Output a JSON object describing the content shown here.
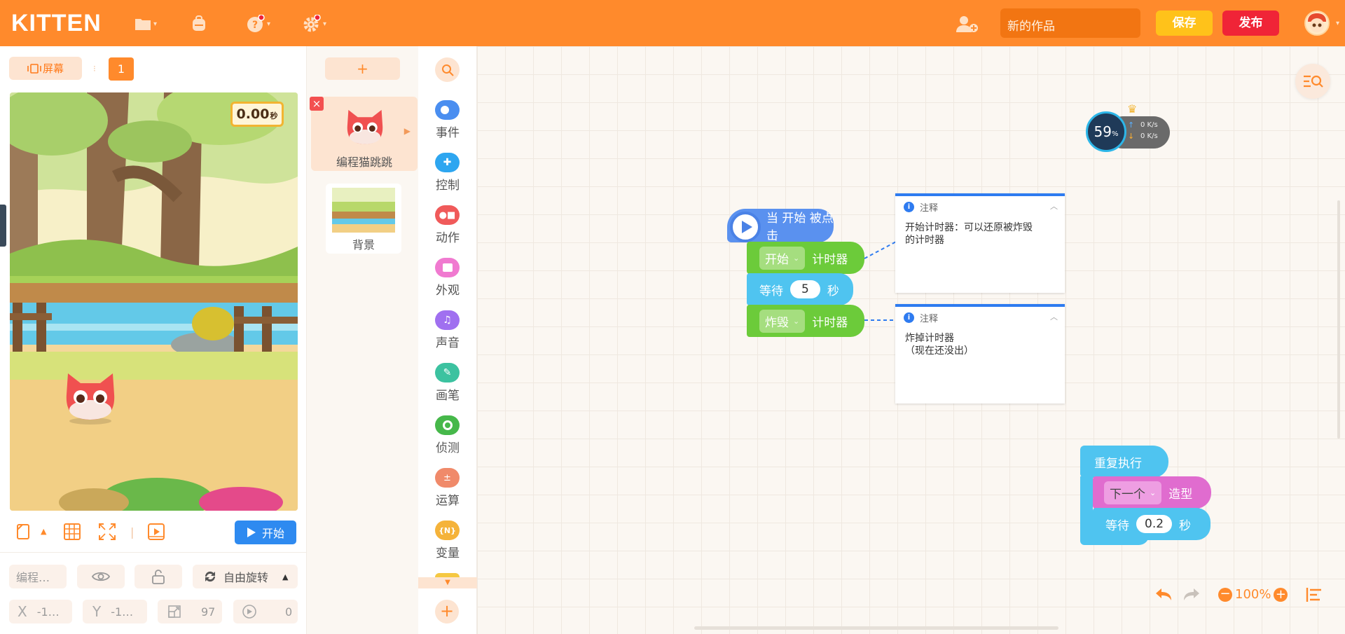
{
  "app": {
    "logo": "KITTEN",
    "project_name_placeholder": "新的作品",
    "save_label": "保存",
    "publish_label": "发布"
  },
  "stage_panel": {
    "screen_label": "屏幕",
    "page_number": "1",
    "timer_value": "0.00",
    "timer_unit": "秒",
    "start_label": "开始",
    "sprite_name_short": "编程…",
    "rotation_label": "自由旋转",
    "x_label": "X",
    "x_value": "-1…",
    "y_label": "Y",
    "y_value": "-1…",
    "size_value": "97",
    "direction_value": "0"
  },
  "sprites": {
    "add_label": "+",
    "items": [
      {
        "name": "编程猫跳跳"
      },
      {
        "name": "背景"
      }
    ]
  },
  "categories": [
    {
      "label": "事件",
      "color": "#4a8ef0"
    },
    {
      "label": "控制",
      "color": "#2ea6f0"
    },
    {
      "label": "动作",
      "color": "#f05a5a"
    },
    {
      "label": "外观",
      "color": "#f07ad0"
    },
    {
      "label": "声音",
      "color": "#a070f0"
    },
    {
      "label": "画笔",
      "color": "#3cc2a0"
    },
    {
      "label": "侦测",
      "color": "#46b84a"
    },
    {
      "label": "运算",
      "color": "#f08a6a"
    },
    {
      "label": "变量",
      "color": "#f5b33a"
    }
  ],
  "network_widget": {
    "percent": "59",
    "percent_unit": "%",
    "up_rate": "0 K/s",
    "down_rate": "0 K/s"
  },
  "blocks": {
    "hat_label": "当 开始 被点击",
    "start_dropdown": "开始",
    "timer_label": "计时器",
    "wait_label": "等待",
    "wait_value": "5",
    "seconds_label": "秒",
    "destroy_dropdown": "炸毁",
    "repeat_label": "重复执行",
    "next_dropdown": "下一个",
    "costume_label": "造型",
    "wait_value_2": "0.2"
  },
  "comments": [
    {
      "title": "注释",
      "text": "开始计时器：可以还原被炸毁\n的计时器"
    },
    {
      "title": "注释",
      "text": "炸掉计时器\n（现在还没出）"
    }
  ],
  "workspace_controls": {
    "zoom": "100%"
  },
  "colors": {
    "topbar": "#ff8a2c",
    "save": "#ffc21a",
    "publish": "#f02437",
    "start": "#2e8af0",
    "event_blue": "#5a91ef",
    "data_green": "#6ccb3a",
    "control_cyan": "#4fc4f0",
    "looks_pink": "#e06ccf"
  }
}
